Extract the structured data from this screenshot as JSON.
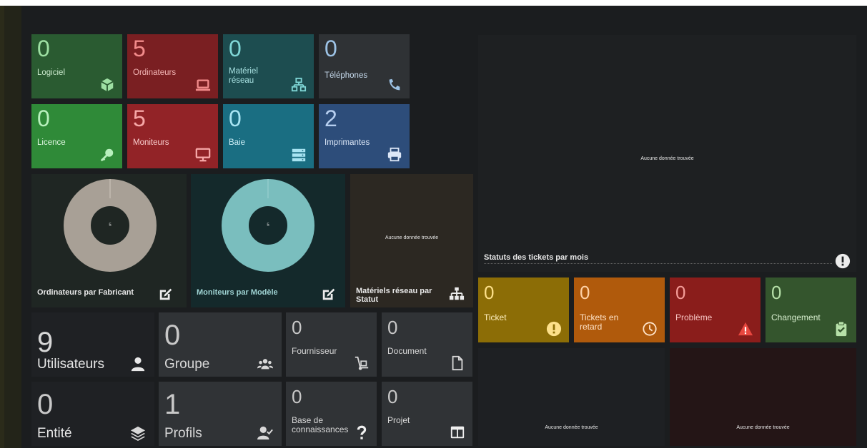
{
  "colors": {
    "background": "#1b1d1f",
    "logiciel": "#2a5b31",
    "ordinateurs": "#7a1f22",
    "materiel_reseau": "#1d4d50",
    "telephones": "#2f3235",
    "licence": "#2f8a38",
    "moniteurs": "#922327",
    "baie": "#1a6e82",
    "imprimantes": "#2d4d7a",
    "ticket": "#8c6d06",
    "tickets_retard": "#b05a0c",
    "probleme": "#8a1d1b",
    "changement": "#34552d",
    "donut_fabricant": "#a8a096",
    "donut_modele": "#7abebe"
  },
  "tiles_top": [
    {
      "value": "0",
      "label": "Logiciel",
      "icon": "box-icon"
    },
    {
      "value": "5",
      "label": "Ordinateurs",
      "icon": "laptop-icon"
    },
    {
      "value": "0",
      "label": "Matériel\nréseau",
      "icon": "network-icon"
    },
    {
      "value": "0",
      "label": "Téléphones",
      "icon": "phone-icon"
    },
    {
      "value": "0",
      "label": "Licence",
      "icon": "key-icon"
    },
    {
      "value": "5",
      "label": "Moniteurs",
      "icon": "monitor-icon"
    },
    {
      "value": "0",
      "label": "Baie",
      "icon": "server-icon"
    },
    {
      "value": "2",
      "label": "Imprimantes",
      "icon": "printer-icon"
    }
  ],
  "charts": {
    "fabricant": {
      "title": "Ordinateurs par Fabricant",
      "center": "5"
    },
    "modele": {
      "title": "Moniteurs par Modèle",
      "center": "5"
    },
    "reseau": {
      "title": "Matériels réseau par\nStatut",
      "nodata": "Aucune donnée trouvée"
    }
  },
  "tickets_panel": {
    "title": "Statuts des tickets par mois",
    "nodata": "Aucune donnée trouvée"
  },
  "ticket_tiles": [
    {
      "value": "0",
      "label": "Ticket",
      "icon": "alert-circle-icon"
    },
    {
      "value": "0",
      "label": "Tickets en\nretard",
      "icon": "clock-icon"
    },
    {
      "value": "0",
      "label": "Problème",
      "icon": "warning-icon"
    },
    {
      "value": "0",
      "label": "Changement",
      "icon": "clipboard-check-icon"
    }
  ],
  "admin_tiles": [
    {
      "value": "9",
      "label": "Utilisateurs",
      "icon": "user-icon"
    },
    {
      "value": "0",
      "label": "Groupe",
      "icon": "users-icon"
    },
    {
      "value": "0",
      "label": "Fournisseur",
      "icon": "dolly-icon"
    },
    {
      "value": "0",
      "label": "Document",
      "icon": "file-icon"
    },
    {
      "value": "0",
      "label": "Entité",
      "icon": "layers-icon"
    },
    {
      "value": "1",
      "label": "Profils",
      "icon": "user-check-icon"
    },
    {
      "value": "0",
      "label": "Base de\nconnaissances",
      "icon": "question-icon"
    },
    {
      "value": "0",
      "label": "Projet",
      "icon": "columns-icon"
    }
  ],
  "bottom_panels": [
    {
      "nodata": "Aucune donnée trouvée"
    },
    {
      "nodata": "Aucune donnée trouvée"
    }
  ]
}
